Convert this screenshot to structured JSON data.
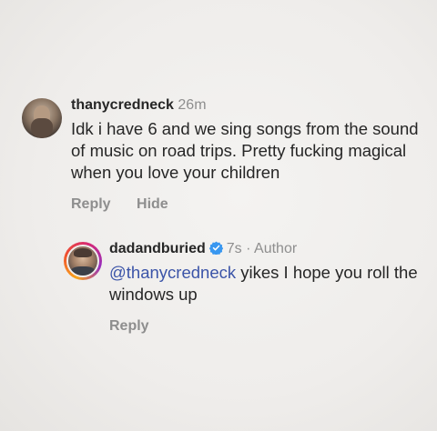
{
  "comment1": {
    "username": "thanycredneck",
    "time": "26m",
    "text": "Idk i have 6 and we sing songs from the sound of music on road trips. Pretty fucking magical when you love your children",
    "reply_label": "Reply",
    "hide_label": "Hide"
  },
  "comment2": {
    "username": "dadandburied",
    "time": "7s",
    "separator": "·",
    "author_label": "Author",
    "mention": "@thanycredneck",
    "text": " yikes I hope you roll the windows up",
    "reply_label": "Reply"
  },
  "icons": {
    "verified": "verified-badge-icon"
  },
  "colors": {
    "background": "#efedeb",
    "text": "#262626",
    "muted": "#8e8e8e",
    "mention": "#3b54a8",
    "verified": "#3897f0"
  }
}
